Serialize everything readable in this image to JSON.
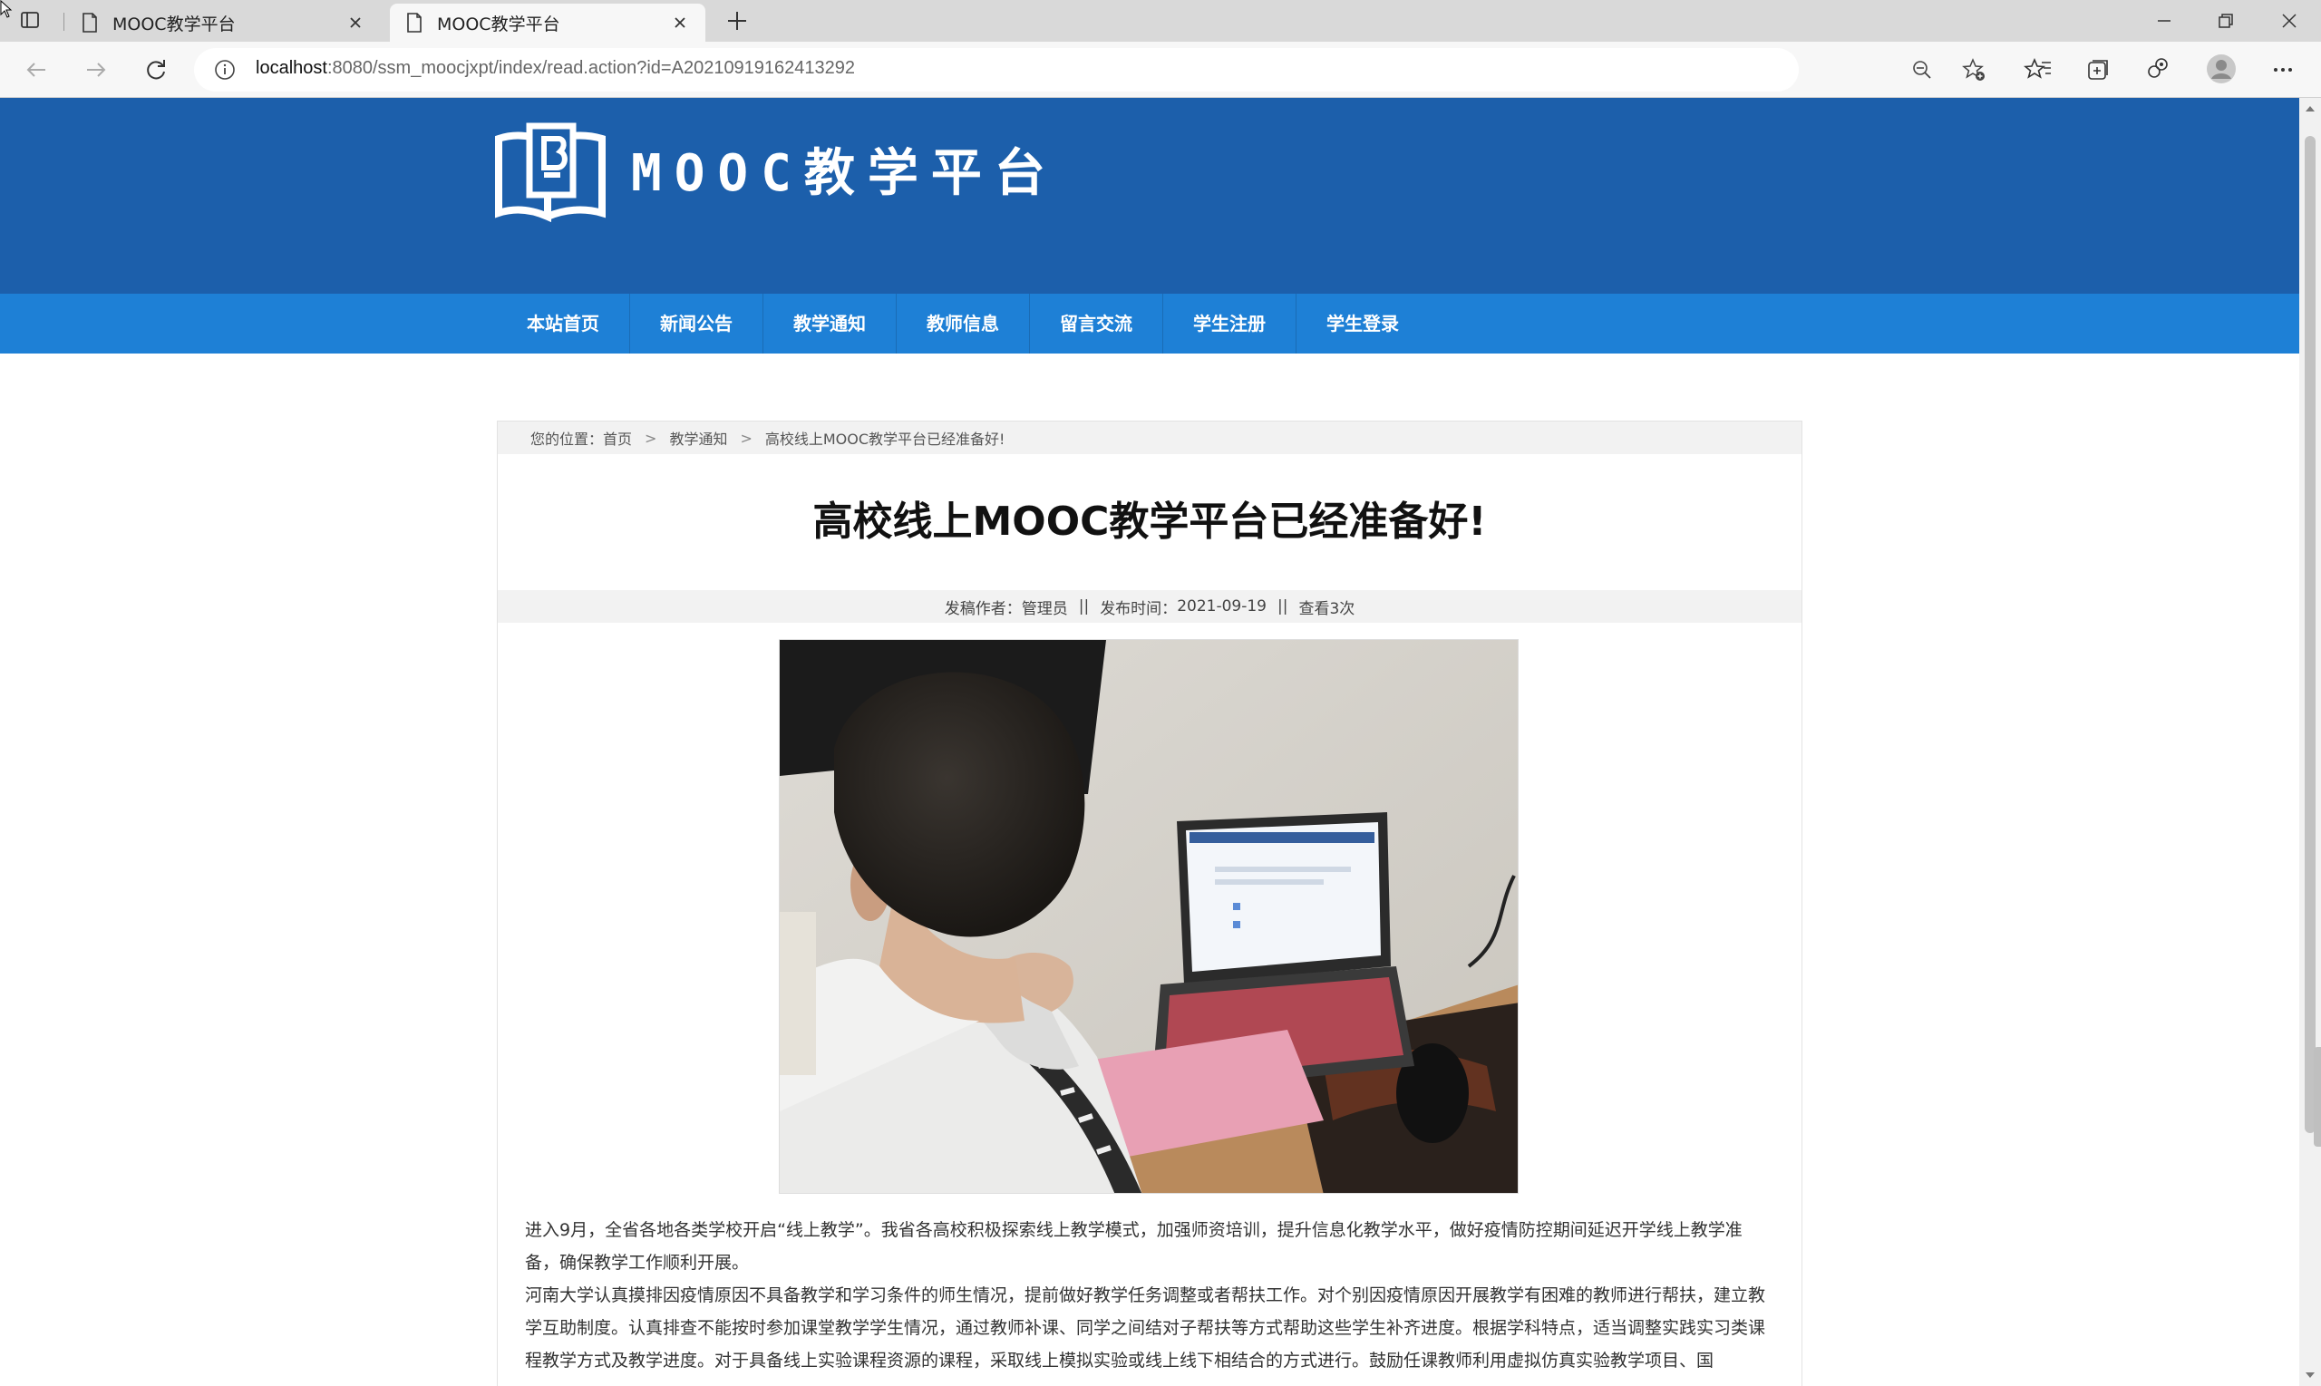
{
  "browser": {
    "tabs": [
      {
        "title": "MOOC教学平台",
        "active": false
      },
      {
        "title": "MOOC教学平台",
        "active": true
      }
    ],
    "address": {
      "host": "localhost",
      "rest": ":8080/ssm_moocjxpt/index/read.action?id=A20210919162413292"
    },
    "icons": [
      "back-icon",
      "forward-icon",
      "refresh-icon",
      "info-icon",
      "zoom-out-icon",
      "add-favorite-icon",
      "favorites-icon",
      "collections-icon",
      "extensions-icon",
      "profile-icon",
      "more-icon"
    ]
  },
  "site": {
    "title": "MOOC教学平台",
    "brand_color": "#1c5fab",
    "nav_color": "#1e80d6",
    "nav": [
      "本站首页",
      "新闻公告",
      "教学通知",
      "教师信息",
      "留言交流",
      "学生注册",
      "学生登录"
    ]
  },
  "breadcrumb": {
    "prefix": "您的位置：",
    "items": [
      "首页",
      "教学通知",
      "高校线上MOOC教学平台已经准备好!"
    ]
  },
  "article": {
    "title": "高校线上MOOC教学平台已经准备好!",
    "author_label": "发稿作者：",
    "author": "管理员",
    "date_label": "发布时间：",
    "date": "2021-09-19",
    "views": "查看3次",
    "paragraphs": [
      "进入9月，全省各地各类学校开启“线上教学”。我省各高校积极探索线上教学模式，加强师资培训，提升信息化教学水平，做好疫情防控期间延迟开学线上教学准备，确保教学工作顺利开展。",
      "河南大学认真摸排因疫情原因不具备教学和学习条件的师生情况，提前做好教学任务调整或者帮扶工作。对个别因疫情原因开展教学有困难的教师进行帮扶，建立教学互助制度。认真排查不能按时参加课堂教学学生情况，通过教师补课、同学之间结对子帮扶等方式帮助这些学生补齐进度。根据学科特点，适当调整实践实习类课程教学方式及教学进度。对于具备线上实验课程资源的课程，采取线上模拟实验或线上线下相结合的方式进行。鼓励任课教师利用虚拟仿真实验教学项目、国"
    ]
  }
}
